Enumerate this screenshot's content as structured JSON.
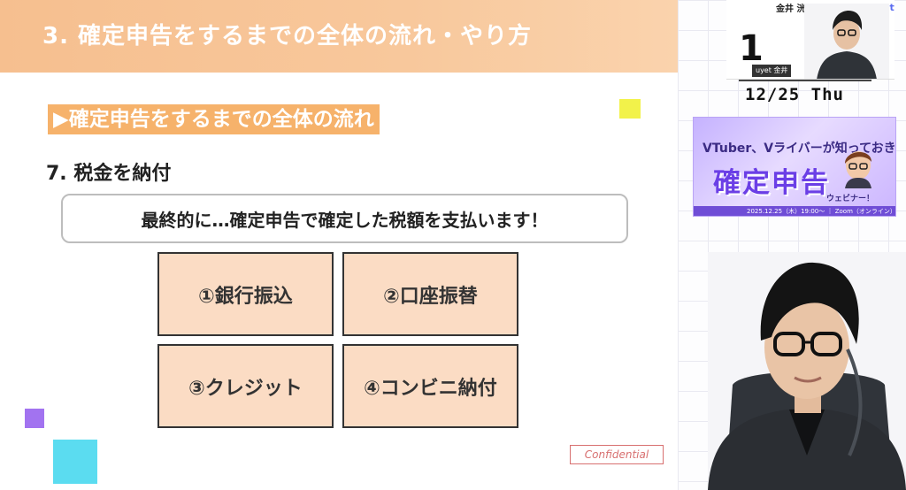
{
  "slide": {
    "header_title": "3. 確定申告をするまでの全体の流れ・やり方",
    "section_title": "▶確定申告をするまでの全体の流れ",
    "step_label": "7.  税金を納付",
    "callout_text": "最終的に…確定申告で確定した税額を支払います！",
    "methods": [
      "①銀行振込",
      "②口座振替",
      "③クレジット",
      "④コンビニ納付"
    ],
    "confidential_label": "Confidential"
  },
  "camera_top": {
    "big_number": "1",
    "speaker_name": "金井 洸樹",
    "name_tag": "uyet 金井",
    "logo": "uyet"
  },
  "date_display": "12/25 Thu",
  "event_banner": {
    "line1": "VTuber、Vライバーが知っておきたい",
    "main_text": "確定申告",
    "sub_text": "ウェビナー！",
    "bottom_text": "2025.12.25（木）19:00〜 ｜ Zoom（オンライン）"
  },
  "colors": {
    "header_orange": "#f6bf8f",
    "section_orange": "#f6b26b",
    "method_fill": "#fbdcc4",
    "banner_purple": "#6b3fe6",
    "confidential_red": "#d87070"
  }
}
